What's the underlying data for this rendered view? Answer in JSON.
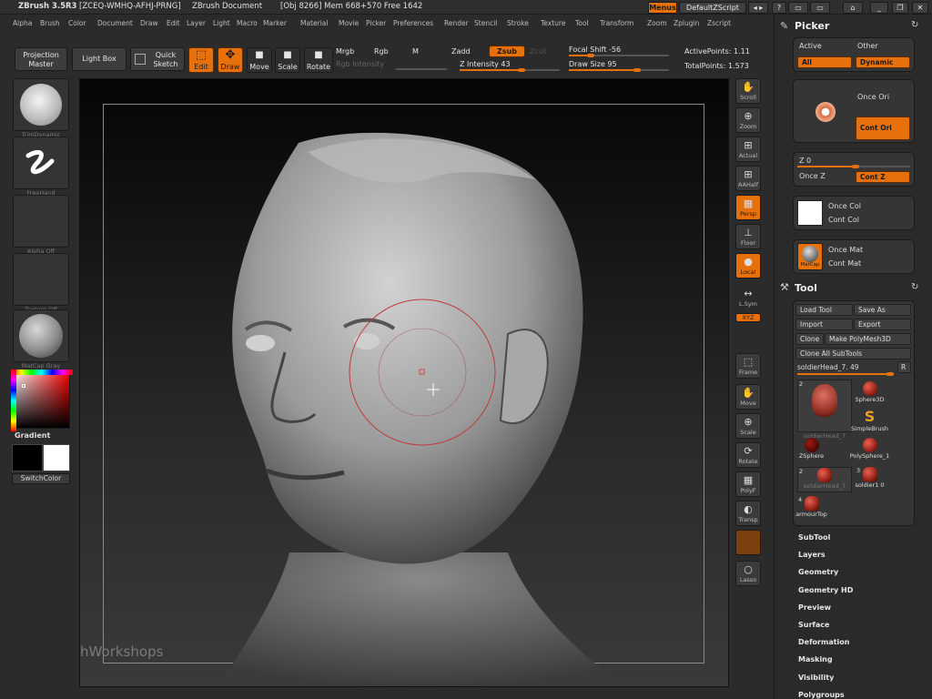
{
  "titlebar": {
    "app": "ZBrush 3.5R3",
    "serial": "[ZCEQ-WMHQ-AFHJ-PRNG]",
    "doc": "ZBrush Document",
    "info": "[Obj 8266] Mem 668+570 Free 1642",
    "menus_btn": "Menus",
    "script": "DefaultZScript"
  },
  "menubar": [
    "Alpha",
    "Brush",
    "Color",
    "Document",
    "Draw",
    "Edit",
    "Layer",
    "Light",
    "Macro",
    "Marker",
    "Material",
    "Movie",
    "Picker",
    "Preferences",
    "Render",
    "Stencil",
    "Stroke",
    "Texture",
    "Tool",
    "Transform",
    "Zoom",
    "Zplugin",
    "Zscript"
  ],
  "shelf": {
    "projection_master": [
      "Projection",
      "Master"
    ],
    "light_box": "Light Box",
    "quick_sketch": [
      "Quick",
      "Sketch"
    ],
    "edit": "Edit",
    "draw": "Draw",
    "move": "Move",
    "scale": "Scale",
    "rotate": "Rotate",
    "mrgb": "Mrgb",
    "rgb": "Rgb",
    "m": "M",
    "rgb_intensity": "Rgb Intensity",
    "zadd": "Zadd",
    "zsub": "Zsub",
    "zcut": "Zcut",
    "z_intensity_label": "Z Intensity",
    "z_intensity": 43,
    "focal_shift_label": "Focal Shift",
    "focal_shift": -56,
    "draw_size_label": "Draw Size",
    "draw_size": 95,
    "active_points": "ActivePoints: 1.11",
    "total_points": "TotalPoints: 1.573"
  },
  "left": {
    "brush": "TrimDynamic",
    "stroke": "FreeHand",
    "alpha": "Alpha Off",
    "texture": "Texture Off",
    "material": "MatCap Gray",
    "gradient": "Gradient",
    "switch_color": "SwitchColor"
  },
  "canvas": {
    "watermark": "ZBrushWorkshops"
  },
  "right_shelf": [
    "Scroll",
    "Zoom",
    "Actual",
    "AAHalf",
    "Persp",
    "Floor",
    "Local",
    "L.Sym",
    "XYZ",
    "Frame",
    "Move",
    "Scale",
    "Rotate",
    "PolyF",
    "Transp",
    "Lasso"
  ],
  "picker": {
    "title": "Picker",
    "active": "Active",
    "other": "Other",
    "all": "All",
    "dynamic": "Dynamic",
    "once_ori": "Once Ori",
    "cont_ori": "Cont Ori",
    "z_label": "Z 0",
    "once_z": "Once Z",
    "cont_z": "Cont Z",
    "once_col": "Once Col",
    "cont_col": "Cont Col",
    "once_mat": "Once Mat",
    "cont_mat": "Cont Mat",
    "matcap": "MatCap"
  },
  "tool": {
    "title": "Tool",
    "load_tool": "Load Tool",
    "save_as": "Save As",
    "import": "Import",
    "export": "Export",
    "clone": "Clone",
    "make_polymesh": "Make PolyMesh3D",
    "clone_all": "Clone All SubTools",
    "current_tool": "soldierHead_7. 49",
    "r": "R",
    "tools": [
      {
        "name": "soldierHead_7",
        "count": "2"
      },
      {
        "name": "Sphere3D",
        "count": ""
      },
      {
        "name": "SimpleBrush",
        "count": ""
      },
      {
        "name": "ZSphere",
        "count": ""
      },
      {
        "name": "PolySphere_1",
        "count": ""
      },
      {
        "name": "soldierHead_7",
        "count": "2"
      },
      {
        "name": "soldier1 0",
        "count": "3"
      },
      {
        "name": "armourTop",
        "count": "4"
      }
    ]
  },
  "sections": [
    "SubTool",
    "Layers",
    "Geometry",
    "Geometry HD",
    "Preview",
    "Surface",
    "Deformation",
    "Masking",
    "Visibility",
    "Polygroups"
  ],
  "colors": {
    "accent": "#e8700a",
    "panel": "#353535",
    "bg": "#2b2b2b"
  }
}
